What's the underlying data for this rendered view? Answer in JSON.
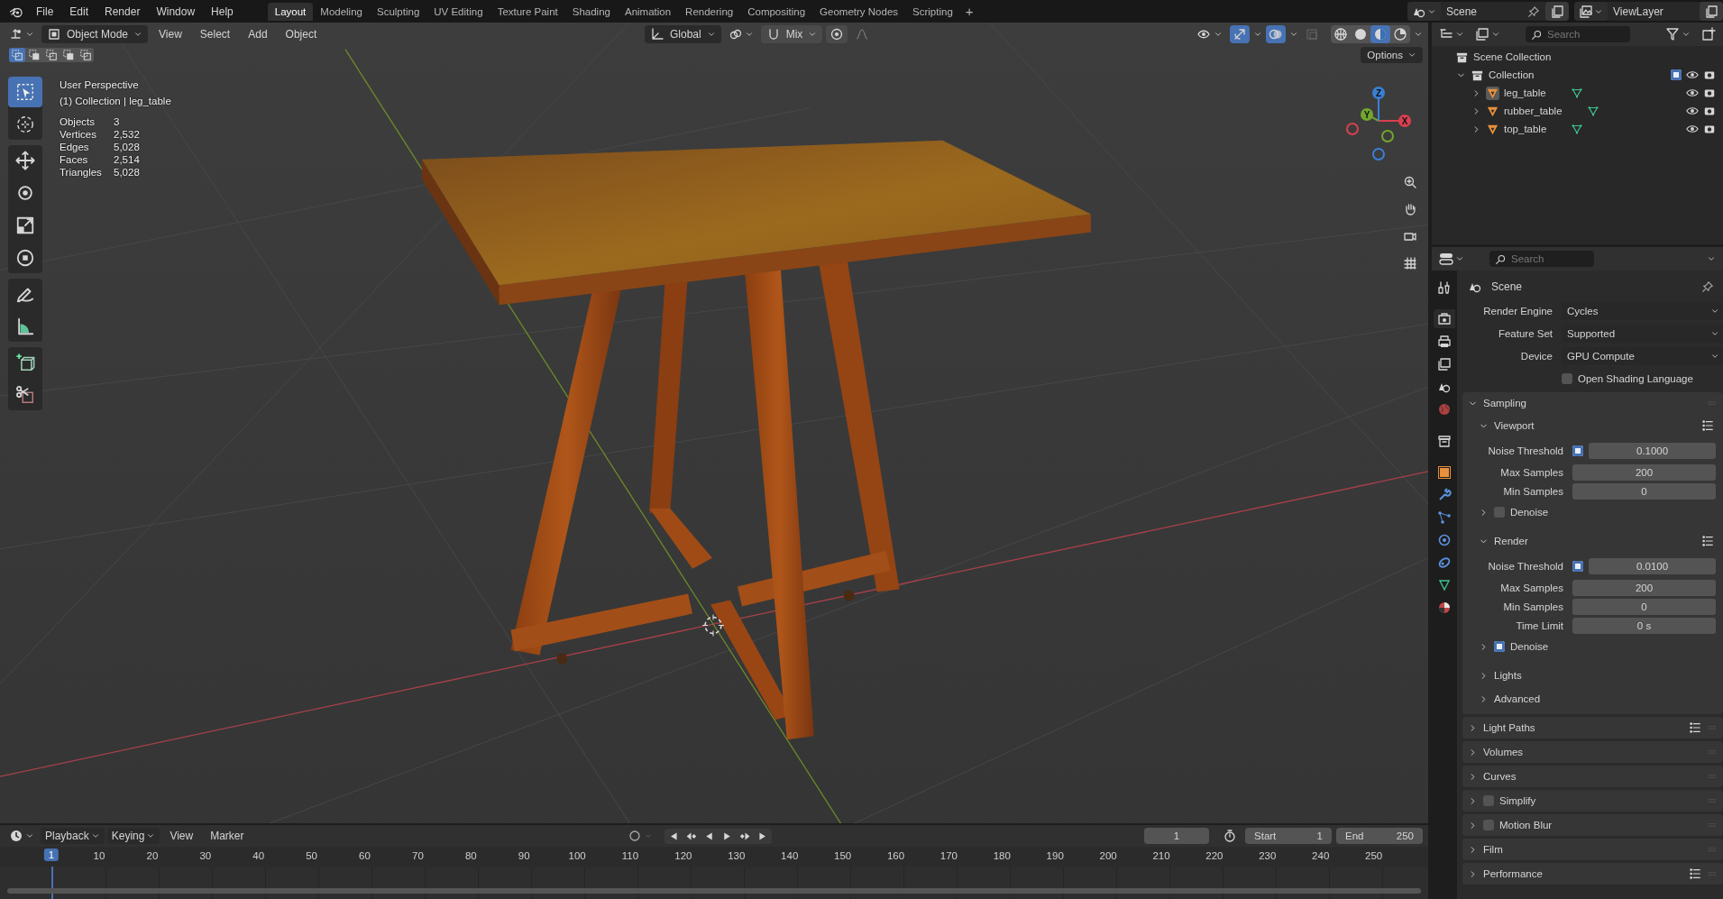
{
  "menu_bar": {
    "items": [
      "File",
      "Edit",
      "Render",
      "Window",
      "Help"
    ]
  },
  "workspace_tabs": [
    {
      "label": "Layout",
      "selected": true
    },
    {
      "label": "Modeling",
      "selected": false
    },
    {
      "label": "Sculpting",
      "selected": false
    },
    {
      "label": "UV Editing",
      "selected": false
    },
    {
      "label": "Texture Paint",
      "selected": false
    },
    {
      "label": "Shading",
      "selected": false
    },
    {
      "label": "Animation",
      "selected": false
    },
    {
      "label": "Rendering",
      "selected": false
    },
    {
      "label": "Compositing",
      "selected": false
    },
    {
      "label": "Geometry Nodes",
      "selected": false
    },
    {
      "label": "Scripting",
      "selected": false
    }
  ],
  "add_workspace": "+",
  "scene_selector": {
    "value": "Scene"
  },
  "view_layer_selector": {
    "value": "ViewLayer"
  },
  "viewport": {
    "header": {
      "mode": "Object Mode",
      "menus": [
        "View",
        "Select",
        "Add",
        "Object"
      ],
      "orientation": "Global",
      "snap_target": "Mix",
      "options": "Options",
      "gizmos_on": true,
      "overlays_on": true,
      "xray_on": false,
      "select_modes": [
        {
          "selected": true
        },
        {
          "selected": false
        },
        {
          "selected": false
        },
        {
          "selected": false
        },
        {
          "selected": false
        }
      ],
      "shading_modes": [
        {
          "selected": false
        },
        {
          "selected": false
        },
        {
          "selected": true
        },
        {
          "selected": false
        }
      ]
    },
    "view_name": "User Perspective",
    "collection_line": "(1) Collection | leg_table",
    "stats": [
      {
        "label": "Objects",
        "value": "3"
      },
      {
        "label": "Vertices",
        "value": "2,532"
      },
      {
        "label": "Edges",
        "value": "5,028"
      },
      {
        "label": "Faces",
        "value": "2,514"
      },
      {
        "label": "Triangles",
        "value": "5,028"
      }
    ],
    "tools": [
      {
        "selected": true
      },
      {
        "selected": false
      },
      {
        "selected": false
      },
      {
        "selected": false
      },
      {
        "selected": false
      },
      {
        "selected": false
      },
      {
        "selected": false
      },
      {
        "selected": false
      },
      {
        "selected": false
      },
      {
        "selected": false
      }
    ],
    "gizmo_axes": [
      {
        "label": "X",
        "color": "#d8404f"
      },
      {
        "label": "Y",
        "color": "#71a72e"
      },
      {
        "label": "Z",
        "color": "#3a7fd4"
      }
    ]
  },
  "outliner": {
    "search_placeholder": "Search",
    "tree": [
      {
        "label": "Scene Collection",
        "kind": "scene_collection",
        "children": [
          {
            "label": "Collection",
            "kind": "collection",
            "expanded": true,
            "checked": true,
            "children": [
              {
                "label": "leg_table",
                "kind": "object",
                "expanded": false,
                "selected": true
              },
              {
                "label": "rubber_table",
                "kind": "object",
                "expanded": false,
                "selected": false
              },
              {
                "label": "top_table",
                "kind": "object",
                "expanded": false,
                "selected": false
              }
            ]
          }
        ]
      }
    ]
  },
  "properties": {
    "search_placeholder": "Search",
    "tabs": [
      {
        "selected": false
      },
      {
        "selected": true
      },
      {
        "selected": false
      },
      {
        "selected": false
      },
      {
        "selected": false
      },
      {
        "selected": false
      },
      {
        "selected": false
      },
      {
        "selected": false
      },
      {
        "selected": false
      },
      {
        "selected": false
      },
      {
        "selected": false
      },
      {
        "selected": false
      },
      {
        "selected": false
      },
      {
        "selected": false
      }
    ],
    "context": "Scene",
    "fields": [
      {
        "kind": "dropdown",
        "label": "Render Engine",
        "value": "Cycles"
      },
      {
        "kind": "dropdown",
        "label": "Feature Set",
        "value": "Supported"
      },
      {
        "kind": "dropdown",
        "label": "Device",
        "value": "GPU Compute"
      },
      {
        "kind": "checkbox",
        "label": "Open Shading Language",
        "checked": false
      }
    ],
    "panels": [
      {
        "title": "Sampling",
        "expanded": true,
        "presets": false,
        "children": [
          {
            "title": "Viewport",
            "expanded": true,
            "presets": true,
            "rows": [
              {
                "kind": "check_number",
                "label": "Noise Threshold",
                "checked": true,
                "value": "0.1000"
              },
              {
                "kind": "number",
                "label": "Max Samples",
                "value": "200"
              },
              {
                "kind": "number",
                "label": "Min Samples",
                "value": "0"
              }
            ],
            "children": [
              {
                "title": "Denoise",
                "expanded": false,
                "checked": false,
                "presets": false
              }
            ]
          },
          {
            "title": "Render",
            "expanded": true,
            "presets": true,
            "rows": [
              {
                "kind": "check_number",
                "label": "Noise Threshold",
                "checked": true,
                "value": "0.0100"
              },
              {
                "kind": "number",
                "label": "Max Samples",
                "value": "200"
              },
              {
                "kind": "number",
                "label": "Min Samples",
                "value": "0"
              },
              {
                "kind": "number",
                "label": "Time Limit",
                "value": "0 s"
              }
            ],
            "children": [
              {
                "title": "Denoise",
                "expanded": false,
                "checked": true,
                "presets": false
              }
            ]
          },
          {
            "title": "Lights",
            "expanded": false,
            "presets": false
          },
          {
            "title": "Advanced",
            "expanded": false,
            "presets": false
          }
        ]
      },
      {
        "title": "Light Paths",
        "expanded": false,
        "presets": true
      },
      {
        "title": "Volumes",
        "expanded": false,
        "presets": false
      },
      {
        "title": "Curves",
        "expanded": false,
        "presets": false
      },
      {
        "title": "Simplify",
        "expanded": false,
        "checked": false,
        "presets": false
      },
      {
        "title": "Motion Blur",
        "expanded": false,
        "checked": false,
        "presets": false
      },
      {
        "title": "Film",
        "expanded": false,
        "presets": false
      },
      {
        "title": "Performance",
        "expanded": false,
        "presets": true
      }
    ]
  },
  "timeline": {
    "menus": [
      "Playback",
      "Keying",
      "View",
      "Marker"
    ],
    "current_frame": "1",
    "start_label": "Start",
    "start": "1",
    "end_label": "End",
    "end": "250",
    "playhead": "1",
    "ruler": [
      "10",
      "20",
      "30",
      "40",
      "50",
      "60",
      "70",
      "80",
      "90",
      "100",
      "110",
      "120",
      "130",
      "140",
      "150",
      "160",
      "170",
      "180",
      "190",
      "200",
      "210",
      "220",
      "230",
      "240",
      "250"
    ]
  }
}
